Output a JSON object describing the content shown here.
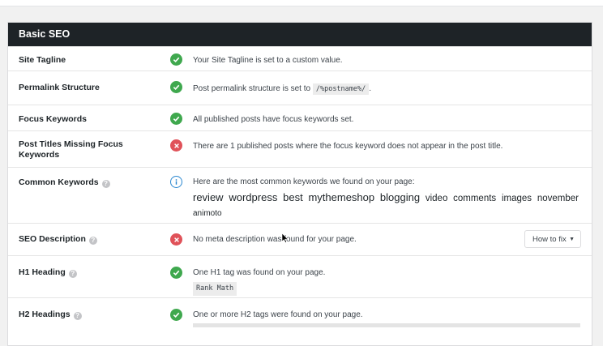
{
  "panel": {
    "title": "Basic SEO"
  },
  "rows": [
    {
      "label": "Site Tagline",
      "status": "ok",
      "text_before": "Your Site Tagline is set to a custom value."
    },
    {
      "label": "Permalink Structure",
      "status": "ok",
      "text_before": "Post permalink structure is set to",
      "code": "/%postname%/",
      "text_after": "."
    },
    {
      "label": "Focus Keywords",
      "status": "ok",
      "text_before": "All published posts have focus keywords set."
    },
    {
      "label": "Post Titles Missing Focus Keywords",
      "status": "fail",
      "text_before": "There are 1 published posts where the focus keyword does not appear in the post title."
    },
    {
      "label": "Common Keywords",
      "status": "info",
      "text_before": "Here are the most common keywords we found on your page:",
      "keywords": [
        {
          "word": "review",
          "size": "large"
        },
        {
          "word": "wordpress",
          "size": "large"
        },
        {
          "word": "best",
          "size": "large"
        },
        {
          "word": "mythemeshop",
          "size": "large"
        },
        {
          "word": "blogging",
          "size": "large"
        },
        {
          "word": "video",
          "size": "medium"
        },
        {
          "word": "comments",
          "size": "medium"
        },
        {
          "word": "images",
          "size": "medium"
        },
        {
          "word": "november",
          "size": "medium"
        },
        {
          "word": "animoto",
          "size": "small"
        }
      ]
    },
    {
      "label": "SEO Description",
      "status": "fail",
      "text_before": "No meta description was found for your page.",
      "button": "How to fix"
    },
    {
      "label": "H1 Heading",
      "status": "ok",
      "text_before": "One H1 tag was found on your page.",
      "tag": "Rank Math"
    },
    {
      "label": "H2 Headings",
      "status": "ok",
      "text_before": "One or more H2 tags were found on your page."
    }
  ],
  "colors": {
    "header_bg": "#1e2327",
    "ok": "#3fa84e",
    "fail": "#e05259",
    "info": "#2a87d0"
  }
}
